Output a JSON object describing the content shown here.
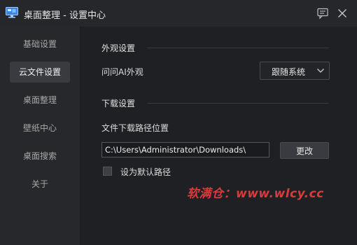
{
  "window": {
    "title": "桌面整理 - 设置中心",
    "icons": {
      "app": "monitor-icon",
      "feedback": "chat-feedback-icon",
      "close": "close-icon"
    }
  },
  "sidebar": {
    "items": [
      {
        "label": "基础设置",
        "active": false
      },
      {
        "label": "云文件设置",
        "active": true
      },
      {
        "label": "桌面整理",
        "active": false
      },
      {
        "label": "壁纸中心",
        "active": false
      },
      {
        "label": "桌面搜索",
        "active": false
      },
      {
        "label": "关于",
        "active": false
      }
    ]
  },
  "main": {
    "appearance": {
      "section_title": "外观设置",
      "ai_label": "问问AI外观",
      "ai_select_value": "跟随系统"
    },
    "download": {
      "section_title": "下载设置",
      "path_label": "文件下载路径位置",
      "path_value": "C:\\Users\\Administrator\\Downloads\\",
      "change_button": "更改",
      "default_checkbox_label": "设为默认路径",
      "default_checked": false
    },
    "watermark": "软满仓：www.wlcy.cc"
  },
  "colors": {
    "accent_watermark": "#d83b3b",
    "active_nav": "#3a3b40"
  }
}
